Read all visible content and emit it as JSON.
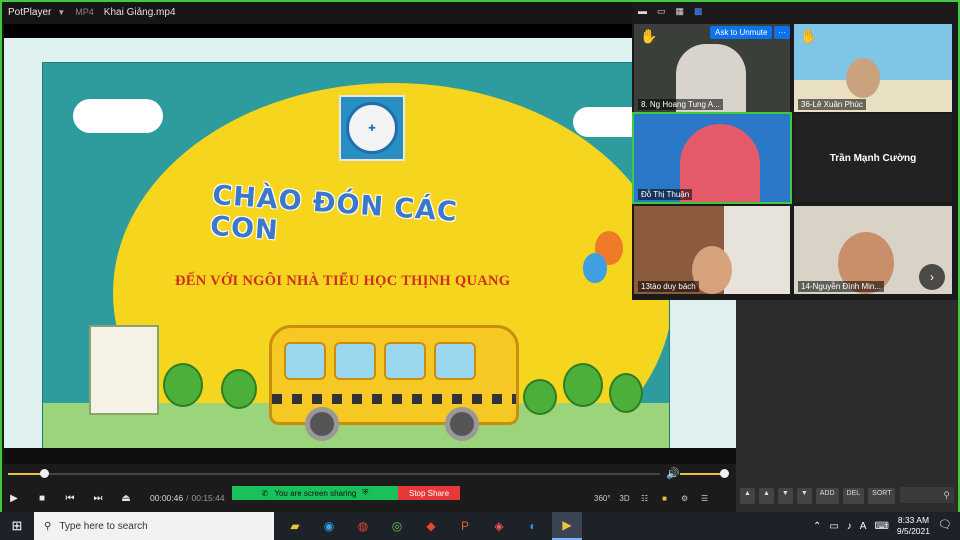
{
  "player": {
    "app_name": "PotPlayer",
    "format": "MP4",
    "file_name": "Khai Giảng.mp4",
    "current_time": "00:00:46",
    "duration": "00:15:44",
    "time_separator": "/",
    "seek_progress": 0.055,
    "volume_level": 0.92
  },
  "slide": {
    "headline": "CHÀO ĐÓN CÁC CON",
    "subline": "ĐẾN VỚI NGÔI NHÀ TIỂU HỌC THỊNH QUANG"
  },
  "sharing": {
    "status": "You are screen sharing",
    "stop_label": "Stop Share"
  },
  "player_controls": {
    "play": "▶",
    "stop": "■",
    "prev": "⏮",
    "next": "⏭",
    "eject": "⏏",
    "degrees": "360°",
    "three_d": "3D",
    "menu": "☰"
  },
  "zoom": {
    "ask_to_unmute": "Ask to Unmute",
    "more": "···",
    "participants": [
      {
        "name": "8. Ng Hoang Tung A..."
      },
      {
        "name": "36-Lê Xuân Phúc"
      },
      {
        "name": "Đỗ Thị Thuận"
      },
      {
        "name": "Trần Mạnh Cường"
      },
      {
        "name": "13tào duy bách"
      },
      {
        "name": "14-Nguyễn Đình Min..."
      }
    ]
  },
  "side_tools": [
    "▲",
    "▲",
    "▼",
    "▼",
    "ADD",
    "DEL",
    "SORT"
  ],
  "taskbar": {
    "search_placeholder": "Type here to search",
    "time": "8:33 AM",
    "date": "9/5/2021",
    "language": "A"
  },
  "colors": {
    "share_green": "#19c15a",
    "stop_red": "#e63838",
    "zoom_blue": "#0e72ed",
    "accent_yellow": "#e8c33a"
  }
}
